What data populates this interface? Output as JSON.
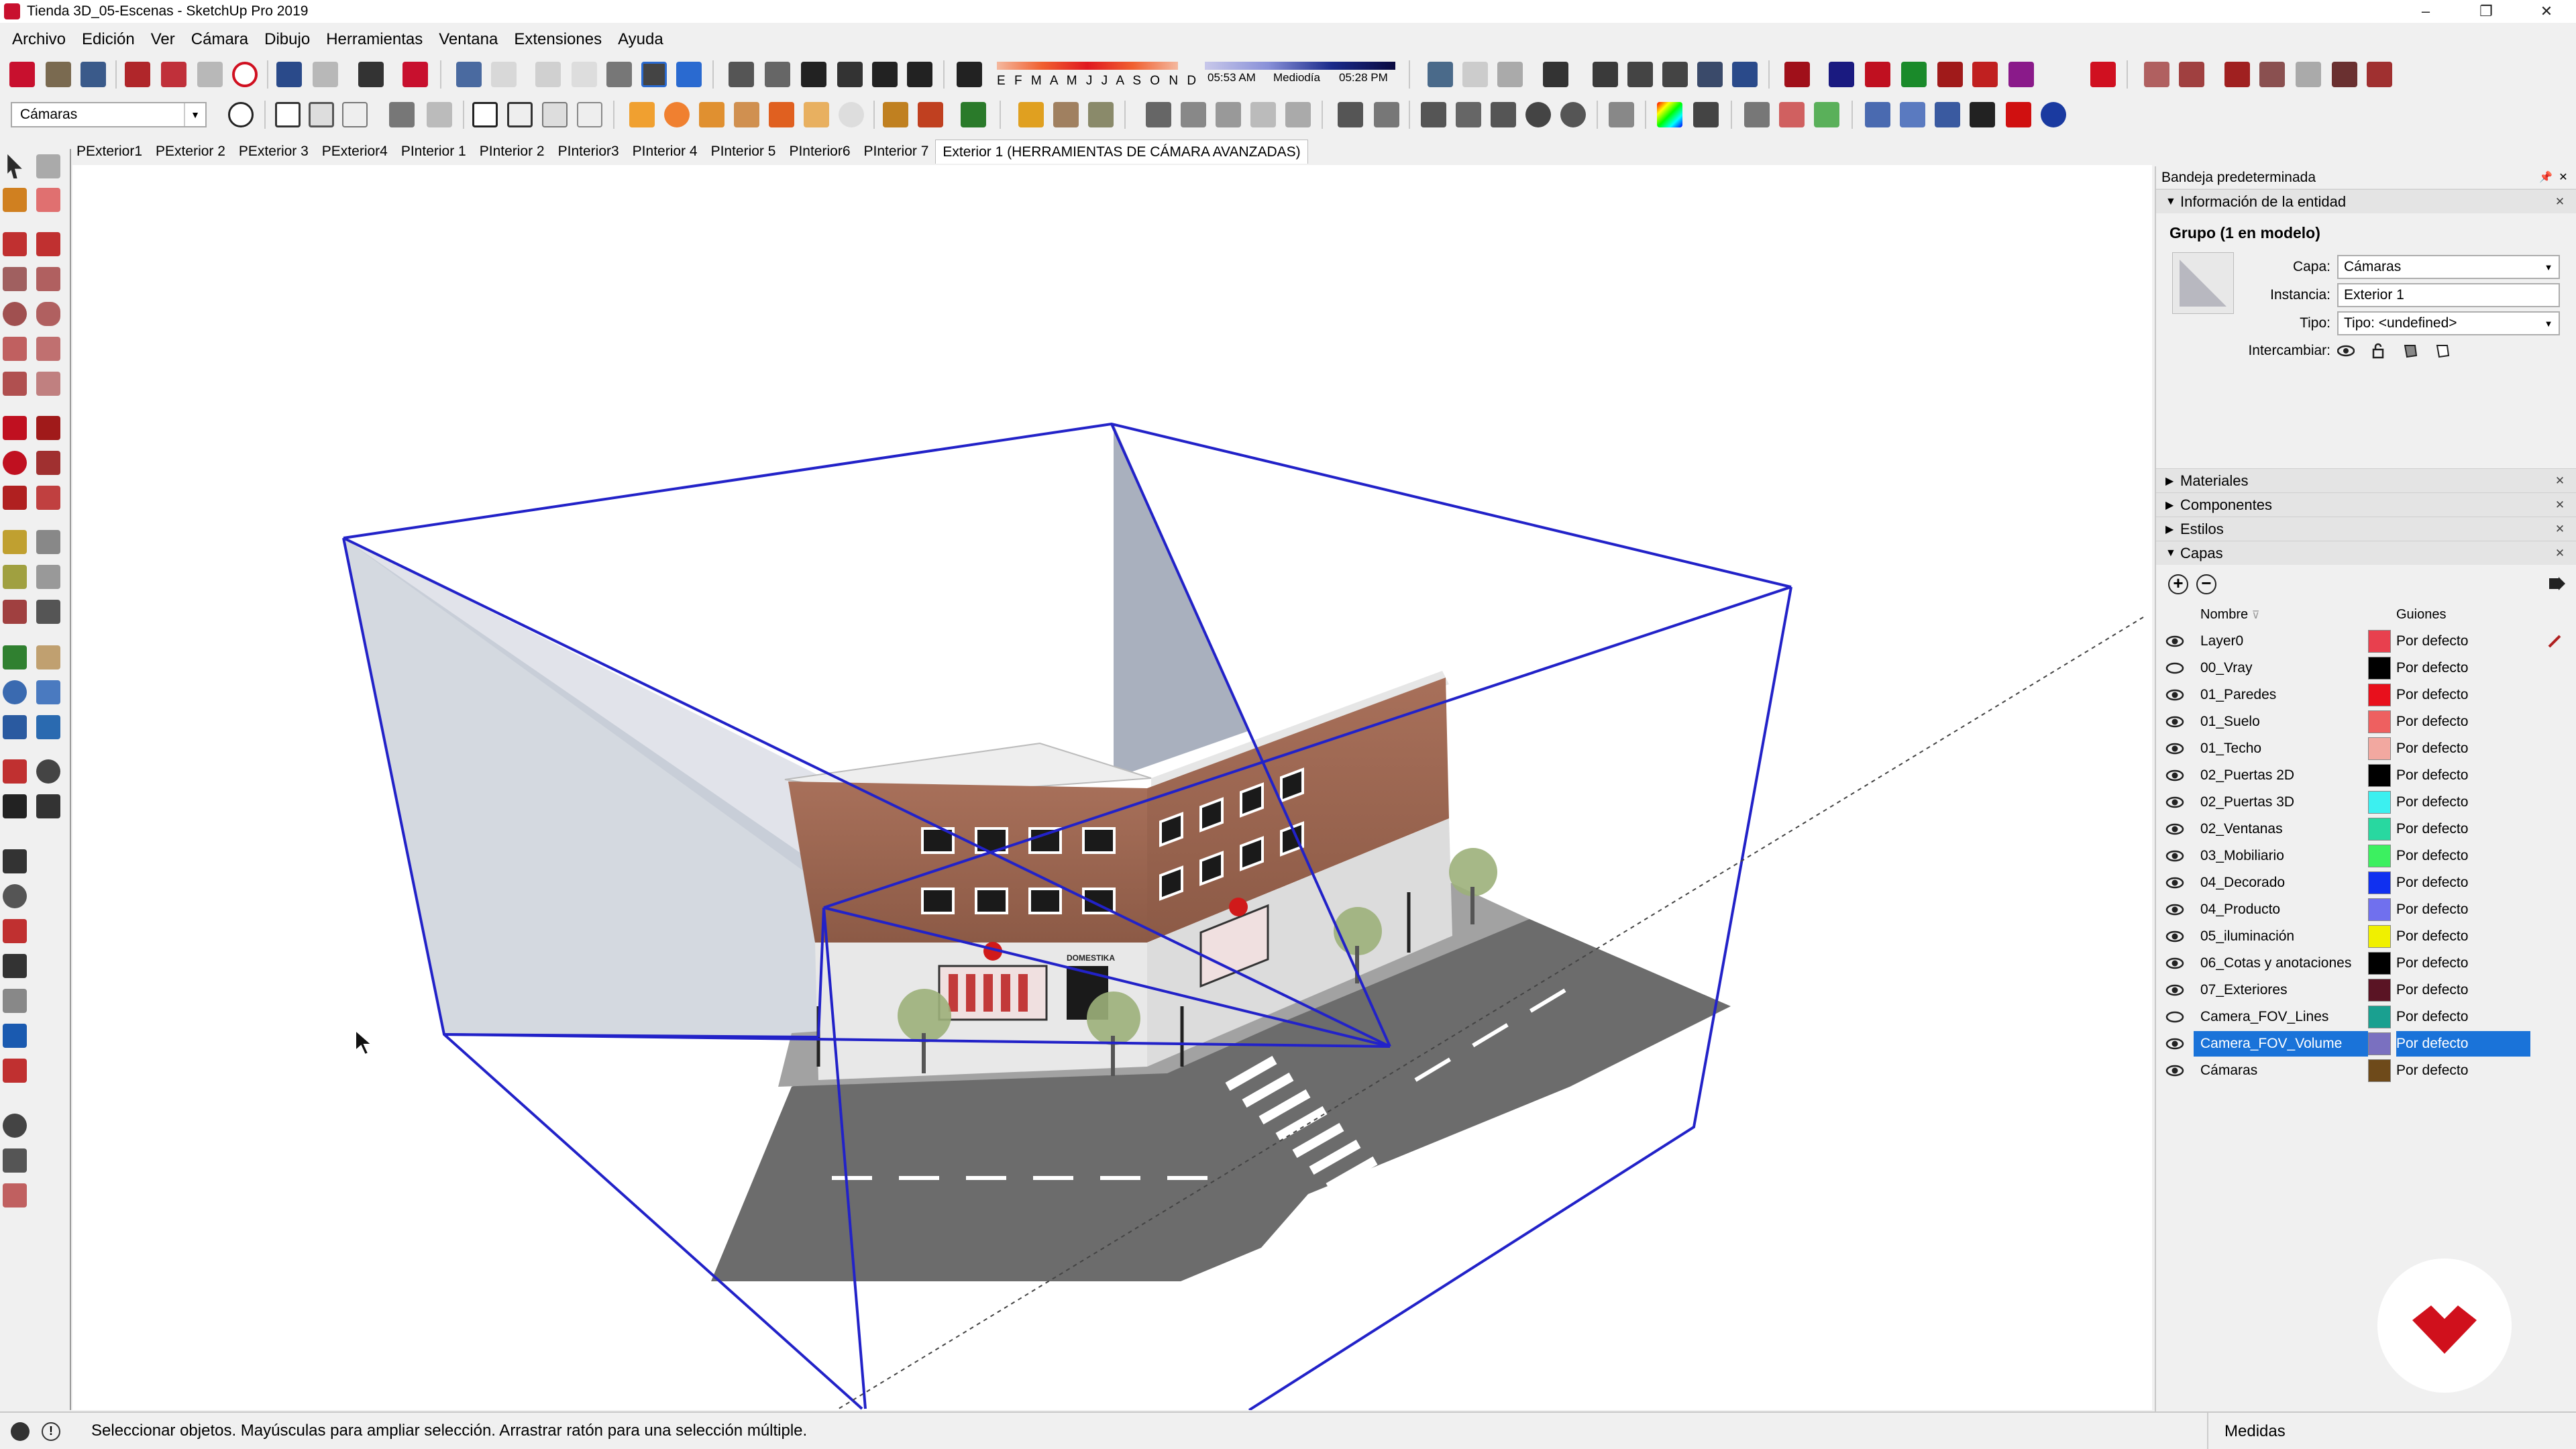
{
  "window": {
    "title": "Tienda 3D_05-Escenas - SketchUp Pro 2019",
    "controls": [
      "–",
      "❐",
      "✕"
    ]
  },
  "menu": [
    "Archivo",
    "Edición",
    "Ver",
    "Cámara",
    "Dibujo",
    "Herramientas",
    "Ventana",
    "Extensiones",
    "Ayuda"
  ],
  "toolbar": {
    "layer_selector": "Cámaras",
    "shadow_months": "E F M A M J J A S O N D",
    "shadow_time_start": "05:53 AM",
    "shadow_time_mid": "Mediodía",
    "shadow_time_end": "05:28 PM"
  },
  "scenes": {
    "tabs": [
      "PExterior1",
      "PExterior 2",
      "PExterior 3",
      "PExterior4",
      "PInterior 1",
      "PInterior 2",
      "PInterior3",
      "PInterior 4",
      "PInterior 5",
      "PInterior6",
      "PInterior 7",
      "Exterior 1 (HERRAMIENTAS DE CÁMARA AVANZADAS)"
    ],
    "active_index": 11
  },
  "tray": {
    "title": "Bandeja predeterminada",
    "entity_panel": {
      "title": "Información de la entidad",
      "selection": "Grupo (1 en modelo)",
      "layer_label": "Capa:",
      "layer_value": "Cámaras",
      "instance_label": "Instancia:",
      "instance_value": "Exterior 1",
      "type_label": "Tipo:",
      "type_value": "Tipo: <undefined>",
      "toggle_label": "Intercambiar:"
    },
    "collapsed_panels": [
      "Materiales",
      "Componentes",
      "Estilos"
    ],
    "layers_panel": {
      "title": "Capas",
      "col_name": "Nombre",
      "col_dashes": "Guiones",
      "rows": [
        {
          "name": "Layer0",
          "visible": true,
          "color": "#e8404e",
          "dashes": "Por defecto",
          "current": true
        },
        {
          "name": "00_Vray",
          "visible": false,
          "color": "#000000",
          "dashes": "Por defecto"
        },
        {
          "name": "01_Paredes",
          "visible": true,
          "color": "#e8101c",
          "dashes": "Por defecto"
        },
        {
          "name": "01_Suelo",
          "visible": true,
          "color": "#ee6060",
          "dashes": "Por defecto"
        },
        {
          "name": "01_Techo",
          "visible": true,
          "color": "#f2a8a0",
          "dashes": "Por defecto"
        },
        {
          "name": "02_Puertas 2D",
          "visible": true,
          "color": "#000000",
          "dashes": "Por defecto"
        },
        {
          "name": "02_Puertas 3D",
          "visible": true,
          "color": "#3cf0f0",
          "dashes": "Por defecto"
        },
        {
          "name": "02_Ventanas",
          "visible": true,
          "color": "#28d8a0",
          "dashes": "Por defecto"
        },
        {
          "name": "03_Mobiliario",
          "visible": true,
          "color": "#3cf060",
          "dashes": "Por defecto"
        },
        {
          "name": "04_Decorado",
          "visible": true,
          "color": "#1030f0",
          "dashes": "Por defecto"
        },
        {
          "name": "04_Producto",
          "visible": true,
          "color": "#7070ee",
          "dashes": "Por defecto"
        },
        {
          "name": "05_iluminación",
          "visible": true,
          "color": "#f0f000",
          "dashes": "Por defecto"
        },
        {
          "name": "06_Cotas y anotaciones",
          "visible": true,
          "color": "#000000",
          "dashes": "Por defecto"
        },
        {
          "name": "07_Exteriores",
          "visible": true,
          "color": "#5a1424",
          "dashes": "Por defecto"
        },
        {
          "name": "Camera_FOV_Lines",
          "visible": false,
          "color": "#1aa090",
          "dashes": "Por defecto"
        },
        {
          "name": "Camera_FOV_Volume",
          "visible": true,
          "color": "#7a70c0",
          "dashes": "Por defecto",
          "selected": true
        },
        {
          "name": "Cámaras",
          "visible": true,
          "color": "#6e4a1a",
          "dashes": "Por defecto"
        }
      ]
    }
  },
  "model": {
    "shop_sign": "DOMESTIKA",
    "selection_color": "#2222c8"
  },
  "status": {
    "message": "Seleccionar objetos. Mayúsculas para ampliar selección. Arrastrar ratón para una selección múltiple.",
    "measure_label": "Medidas"
  }
}
